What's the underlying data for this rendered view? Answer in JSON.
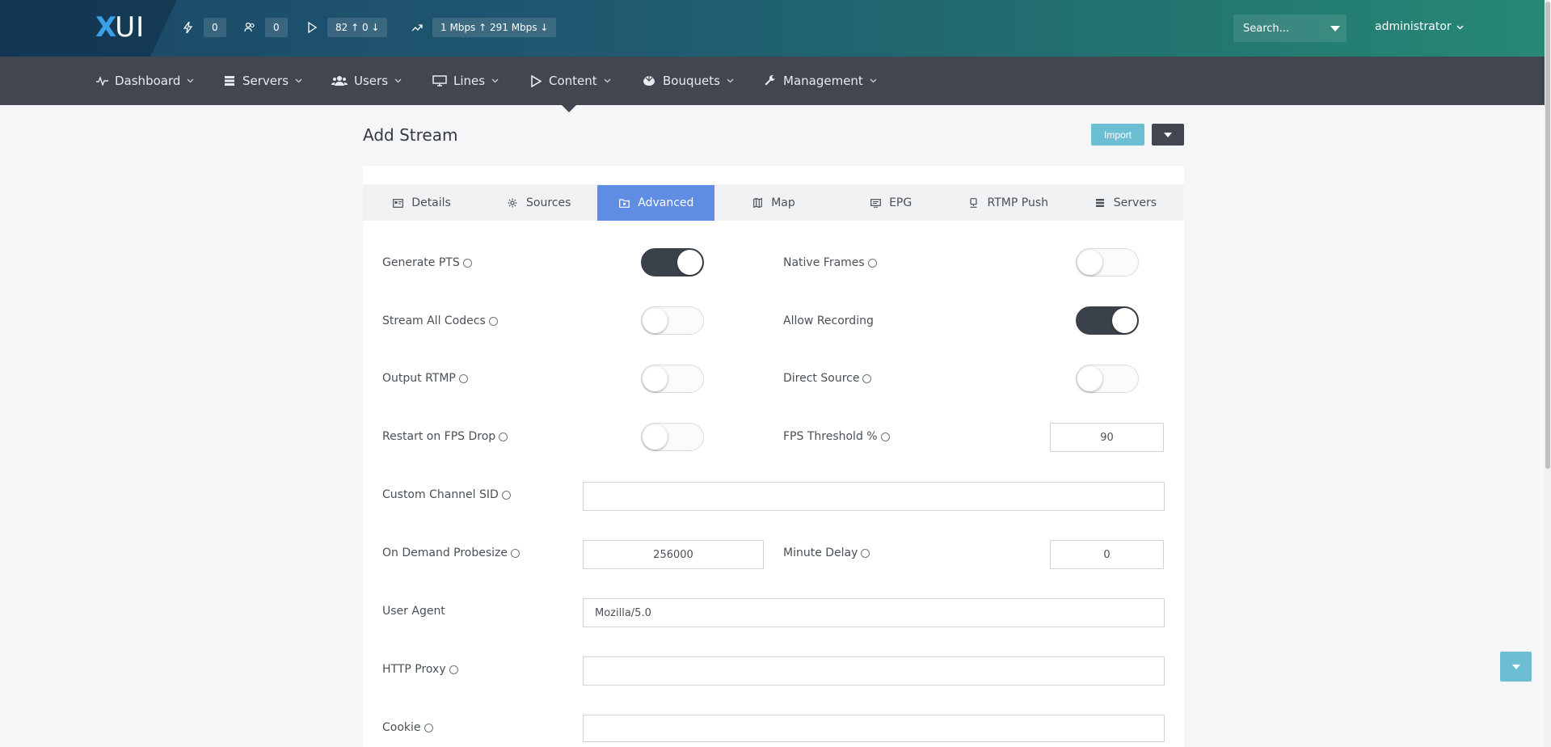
{
  "brand": {
    "x": "X",
    "ui": "UI"
  },
  "topbar": {
    "stats": [
      {
        "icon": "bolt-icon",
        "value": "0"
      },
      {
        "icon": "users-icon",
        "value": "0"
      },
      {
        "icon": "play-icon",
        "value": "82 ↑ 0 ↓"
      },
      {
        "icon": "trend-icon",
        "value": "1 Mbps ↑ 291 Mbps ↓"
      }
    ],
    "search_label": "Search...",
    "user_label": "administrator"
  },
  "nav": [
    {
      "label": "Dashboard",
      "icon": "activity-icon"
    },
    {
      "label": "Servers",
      "icon": "server-icon"
    },
    {
      "label": "Users",
      "icon": "users-icon"
    },
    {
      "label": "Lines",
      "icon": "monitor-icon"
    },
    {
      "label": "Content",
      "icon": "play-icon"
    },
    {
      "label": "Bouquets",
      "icon": "bouquet-icon"
    },
    {
      "label": "Management",
      "icon": "wrench-icon"
    }
  ],
  "page": {
    "title": "Add Stream",
    "import_label": "Import"
  },
  "tabs": [
    {
      "label": "Details",
      "icon": "id-card-icon",
      "active": false
    },
    {
      "label": "Sources",
      "icon": "gear-icon",
      "active": false
    },
    {
      "label": "Advanced",
      "icon": "folder-icon",
      "active": true
    },
    {
      "label": "Map",
      "icon": "map-icon",
      "active": false
    },
    {
      "label": "EPG",
      "icon": "screen-icon",
      "active": false
    },
    {
      "label": "RTMP Push",
      "icon": "upload-icon",
      "active": false
    },
    {
      "label": "Servers",
      "icon": "server-icon",
      "active": false
    }
  ],
  "form": {
    "generate_pts": {
      "label": "Generate PTS",
      "on": true
    },
    "native_frames": {
      "label": "Native Frames",
      "on": false
    },
    "stream_all_codecs": {
      "label": "Stream All Codecs",
      "on": false
    },
    "allow_recording": {
      "label": "Allow Recording",
      "on": true
    },
    "output_rtmp": {
      "label": "Output RTMP",
      "on": false
    },
    "direct_source": {
      "label": "Direct Source",
      "on": false
    },
    "restart_fps_drop": {
      "label": "Restart on FPS Drop",
      "on": false
    },
    "fps_threshold": {
      "label": "FPS Threshold %",
      "value": "90"
    },
    "custom_channel_sid": {
      "label": "Custom Channel SID",
      "value": ""
    },
    "on_demand_probesize": {
      "label": "On Demand Probesize",
      "value": "256000"
    },
    "minute_delay": {
      "label": "Minute Delay",
      "value": "0"
    },
    "user_agent": {
      "label": "User Agent",
      "value": "Mozilla/5.0"
    },
    "http_proxy": {
      "label": "HTTP Proxy",
      "value": ""
    },
    "cookie": {
      "label": "Cookie",
      "value": ""
    }
  }
}
